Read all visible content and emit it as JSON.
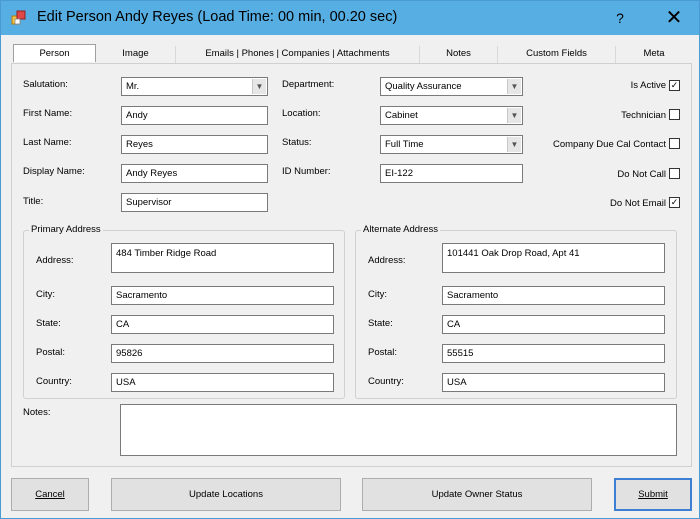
{
  "window": {
    "title": "Edit Person Andy Reyes (Load Time: 00 min, 00.20 sec)",
    "help_glyph": "?",
    "close_glyph": "✕"
  },
  "tabs": [
    {
      "label": "Person"
    },
    {
      "label": "Image"
    },
    {
      "label": "Emails | Phones | Companies | Attachments"
    },
    {
      "label": "Notes"
    },
    {
      "label": "Custom Fields"
    },
    {
      "label": "Meta"
    }
  ],
  "person": {
    "salutation_label": "Salutation:",
    "salutation_value": "Mr.",
    "first_name_label": "First Name:",
    "first_name_value": "Andy",
    "last_name_label": "Last Name:",
    "last_name_value": "Reyes",
    "display_name_label": "Display Name:",
    "display_name_value": "Andy Reyes",
    "title_label": "Title:",
    "title_value": "Supervisor",
    "department_label": "Department:",
    "department_value": "Quality Assurance",
    "location_label": "Location:",
    "location_value": "Cabinet",
    "status_label": "Status:",
    "status_value": "Full Time",
    "id_number_label": "ID Number:",
    "id_number_value": "EI-122"
  },
  "flags": {
    "is_active_label": "Is Active",
    "is_active_checked": true,
    "technician_label": "Technician",
    "technician_checked": false,
    "company_due_cal_label": "Company Due Cal Contact",
    "company_due_cal_checked": false,
    "do_not_call_label": "Do Not Call",
    "do_not_call_checked": false,
    "do_not_email_label": "Do Not Email",
    "do_not_email_checked": true
  },
  "primary_address": {
    "group_label": "Primary Address",
    "address_label": "Address:",
    "address_value": "484 Timber Ridge Road",
    "city_label": "City:",
    "city_value": "Sacramento",
    "state_label": "State:",
    "state_value": "CA",
    "postal_label": "Postal:",
    "postal_value": "95826",
    "country_label": "Country:",
    "country_value": "USA"
  },
  "alternate_address": {
    "group_label": "Alternate Address",
    "address_label": "Address:",
    "address_value": "101441 Oak Drop Road, Apt 41",
    "city_label": "City:",
    "city_value": "Sacramento",
    "state_label": "State:",
    "state_value": "CA",
    "postal_label": "Postal:",
    "postal_value": "55515",
    "country_label": "Country:",
    "country_value": "USA"
  },
  "notes": {
    "label": "Notes:",
    "value": ""
  },
  "buttons": {
    "cancel_label": "Cancel",
    "update_locations_label": "Update Locations",
    "update_owner_status_label": "Update Owner Status",
    "submit_label": "Submit"
  },
  "colors": {
    "titlebar": "#57aee3",
    "window_bg": "#f0f0f0",
    "default_button_border": "#3c7fd3"
  }
}
